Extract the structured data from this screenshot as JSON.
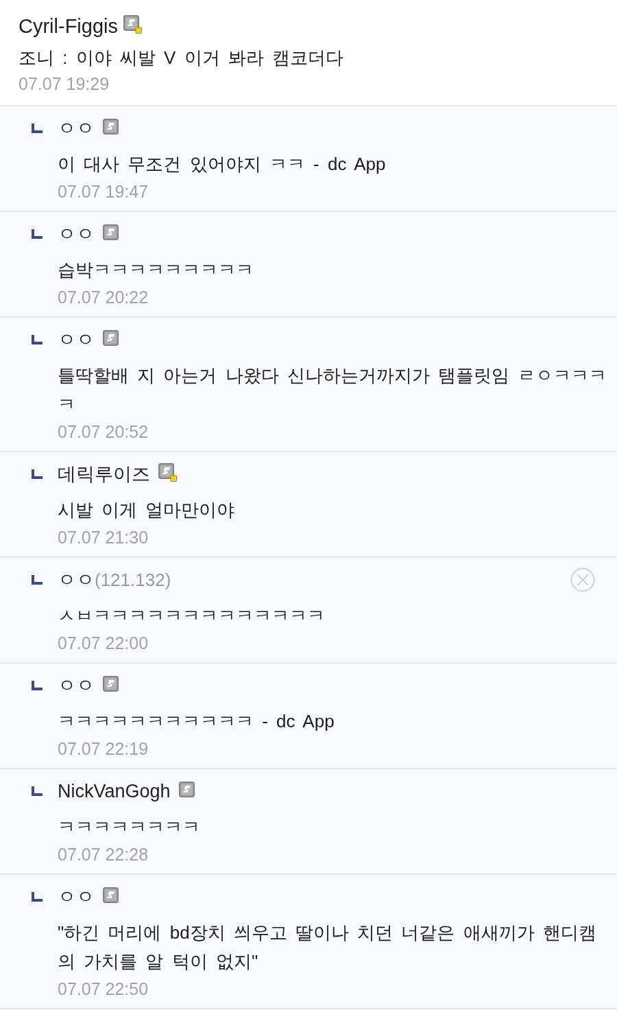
{
  "comment": {
    "author": "Cyril-Figgis",
    "kind": "member",
    "fixed": true,
    "text": "조니 : 이야 씨발 V 이거 봐라 캠코더다",
    "date": "07.07 19:29"
  },
  "replies": [
    {
      "author": "ㅇㅇ",
      "kind": "member",
      "fixed": false,
      "text": "이 대사 무조건 있어야지 ㅋㅋ - dc App",
      "date": "07.07 19:47",
      "deletable": false
    },
    {
      "author": "ㅇㅇ",
      "kind": "member",
      "fixed": false,
      "text": "습박ㅋㅋㅋㅋㅋㅋㅋㅋㅋ",
      "date": "07.07 20:22",
      "deletable": false
    },
    {
      "author": "ㅇㅇ",
      "kind": "member",
      "fixed": false,
      "text": "틀딱할배 지 아는거 나왔다 신나하는거까지가 탬플릿임 ㄹㅇㅋㅋㅋㅋ",
      "date": "07.07 20:52",
      "deletable": false
    },
    {
      "author": "데릭루이즈",
      "kind": "member",
      "fixed": true,
      "text": "시발 이게 얼마만이야",
      "date": "07.07 21:30",
      "deletable": false
    },
    {
      "author": "ㅇㅇ",
      "kind": "guest",
      "ip": "(121.132)",
      "text": "ㅅㅂㅋㅋㅋㅋㅋㅋㅋㅋㅋㅋㅋㅋㅋ",
      "date": "07.07 22:00",
      "deletable": true
    },
    {
      "author": "ㅇㅇ",
      "kind": "member",
      "fixed": false,
      "text": "ㅋㅋㅋㅋㅋㅋㅋㅋㅋㅋㅋ - dc App",
      "date": "07.07 22:19",
      "deletable": false
    },
    {
      "author": "NickVanGogh",
      "kind": "member",
      "fixed": false,
      "text": "ㅋㅋㅋㅋㅋㅋㅋㅋ",
      "date": "07.07 22:28",
      "deletable": false
    },
    {
      "author": "ㅇㅇ",
      "kind": "member",
      "fixed": false,
      "text": "\"하긴 머리에 bd장치 씌우고 딸이나 치던 너같은 애새끼가 핸디캠의 가치를 알 턱이 없지\"",
      "date": "07.07 22:50",
      "deletable": false
    }
  ]
}
